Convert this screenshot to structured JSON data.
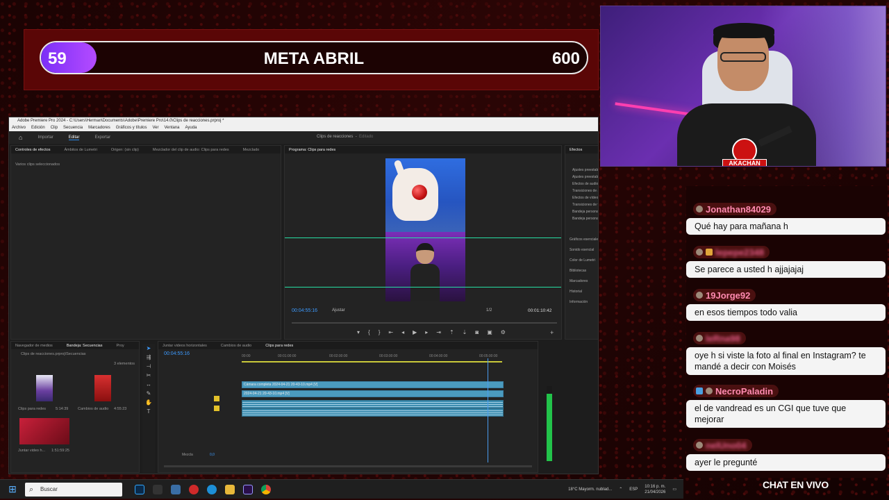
{
  "goal": {
    "current": "59",
    "title": "META ABRIL",
    "max": "600",
    "progress_fraction": 0.098
  },
  "premiere": {
    "title_bar": "Adobe Premiere Pro 2024 - C:\\Users\\Herman\\Documents\\Adobe\\Premiere Pro\\14.0\\Clips de reacciones.prproj *",
    "menu": [
      "Archivo",
      "Edición",
      "Clip",
      "Secuencia",
      "Marcadores",
      "Gráficos y títulos",
      "Ver",
      "Ventana",
      "Ayuda"
    ],
    "workspace_tabs": [
      "Importar",
      "Editar",
      "Exportar"
    ],
    "workspace_active": "Editar",
    "project_center": "Clips de reacciones",
    "project_status": "Editado",
    "source_tabs": [
      "Controles de efectos",
      "Ámbitos de Lumetri",
      "Origen: (sin clip)",
      "Mezclador del clip de audio: Clips para redes",
      "Mezclado"
    ],
    "source_empty": "Varios clips seleccionados",
    "program_tab": "Programa: Clips para redes",
    "program_timecode": "00:04:55:16",
    "program_fit": "Ajustar",
    "program_ratio": "1/2",
    "program_duration": "00:01:10:42",
    "effects_title": "Efectos",
    "effects_tree": [
      "Ajustes preestablecidos",
      "Ajustes preestablecidos de Lumetri",
      "Efectos de audio",
      "Transiciones de audio",
      "Efectos de vídeo",
      "Transiciones de vídeo",
      "Bandeja personalizada 01",
      "Bandeja personalizada 02"
    ],
    "effects_side": [
      "Gráficos esenciales",
      "Sonido esencial",
      "Color de Lumetri",
      "Bibliotecas",
      "Marcadores",
      "Historial",
      "Información"
    ],
    "project_tabs": [
      "Navegador de medios",
      "Bandeja: Secuencias",
      "Proy"
    ],
    "project_path": "Clips de reacciones.prproj\\Secuencias",
    "project_count": "3 elementos",
    "project_items": [
      {
        "name": "Clips para redes",
        "duration": "5:14:39"
      },
      {
        "name": "Cambios de audio",
        "duration": "4:55:23"
      },
      {
        "name": "Juntar video h...",
        "duration": "1:51:59:25"
      }
    ],
    "timeline_tabs": [
      "Juntar videos horizontales",
      "Cambios de audio",
      "Clips para redes"
    ],
    "timeline_timecode": "00:04:55:16",
    "ruler": [
      "00:00",
      "00:01:00:00",
      "00:02:00:00",
      "00:03:00:00",
      "00:04:00:00",
      "00:05:00:00"
    ],
    "clip_v2": "Cámara completa 2024-04-21 20-43-10.mp4 [V]",
    "clip_v1": "2024-04-21 20-43-10.mp4 [V]",
    "mix_label": "Mezcla",
    "mix_value": "0,0"
  },
  "webcam": {
    "badge": "AKACHAN"
  },
  "chat": {
    "messages": [
      {
        "user": "Jonathan84029",
        "text": "Qué hay para mañana h",
        "blurred": false
      },
      {
        "user": "lepepe2348",
        "text": "Se parece a usted h ajjajajaj",
        "blurred": true
      },
      {
        "user": "19Jorge92",
        "text": "en esos tiempos todo valia",
        "blurred": false
      },
      {
        "user": "leRna98",
        "text": "oye h si viste la foto al final en Instagram? te mandé a decir con Moisés",
        "blurred": true
      },
      {
        "user": "NecroPaladin",
        "text": "el de vandread es un CGI que tuve que mejorar",
        "blurred": false
      },
      {
        "user": "nelUno04",
        "text": "ayer le pregunté",
        "blurred": true
      }
    ],
    "footer": "CHAT EN VIVO"
  },
  "taskbar": {
    "search_placeholder": "Buscar",
    "weather": "18°C  Mayorm. nublad...",
    "lang": "ESP",
    "time": "10:16 p. m.",
    "date": "21/04/2026"
  }
}
